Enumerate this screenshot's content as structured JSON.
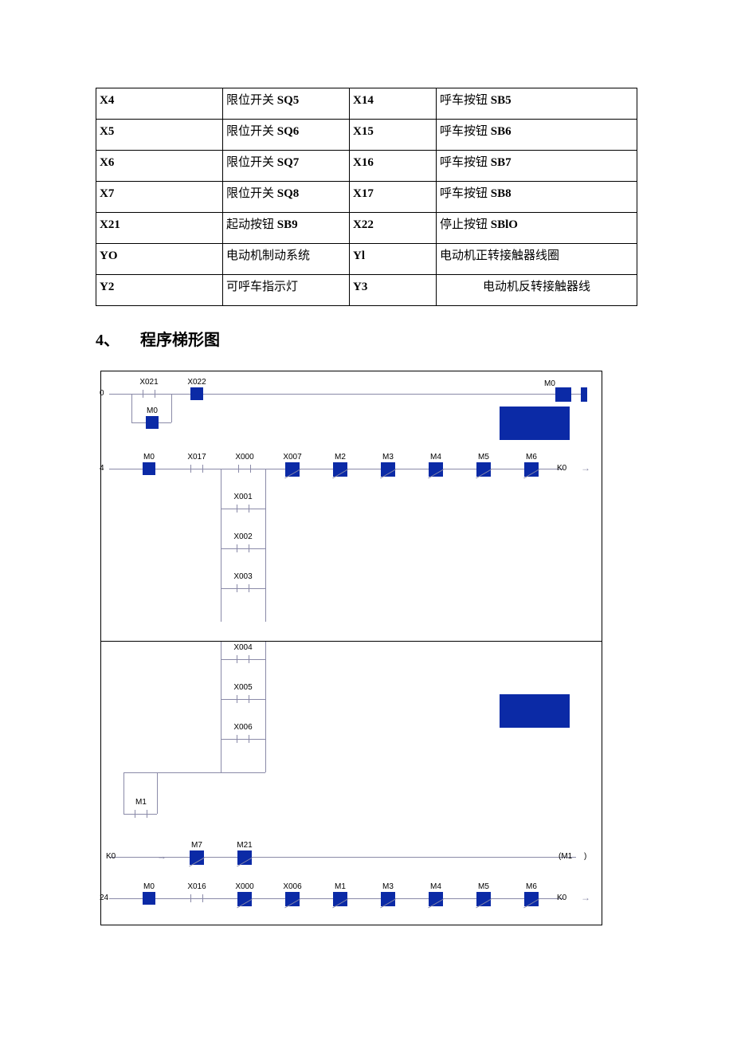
{
  "io_table": {
    "rows": [
      {
        "c1": "X4",
        "c2_pre": "限位开关 ",
        "c2_b": "SQ5",
        "c3": "X14",
        "c4_pre": "呼车按钮 ",
        "c4_b": "SB5"
      },
      {
        "c1": "X5",
        "c2_pre": "限位开关 ",
        "c2_b": "SQ6",
        "c3": "X15",
        "c4_pre": "呼车按钮 ",
        "c4_b": "SB6"
      },
      {
        "c1": "X6",
        "c2_pre": "限位开关 ",
        "c2_b": "SQ7",
        "c3": "X16",
        "c4_pre": "呼车按钮 ",
        "c4_b": "SB7"
      },
      {
        "c1": "X7",
        "c2_pre": "限位开关 ",
        "c2_b": "SQ8",
        "c3": "X17",
        "c4_pre": "呼车按钮 ",
        "c4_b": "SB8"
      },
      {
        "c1": "X21",
        "c2_pre": "起动按钮 ",
        "c2_b": "SB9",
        "c3": "X22",
        "c4_pre": "停止按钮 ",
        "c4_b": "SBlO"
      },
      {
        "c1": "YO",
        "c2_pre": "电动机制动系统",
        "c2_b": "",
        "c3": "Yl",
        "c4_pre": "电动机正转接触器线圈",
        "c4_b": "",
        "tight": true
      },
      {
        "c1": "Y2",
        "c2_pre": "可呼车指示灯",
        "c2_b": "",
        "c3": "Y3",
        "c4_pre": "电动机反转接触器线",
        "c4_b": "",
        "center4": true
      }
    ]
  },
  "section": {
    "num": "4、",
    "title": "程序梯形图"
  },
  "ladder": {
    "block1": {
      "step0": "0",
      "step4": "4",
      "r0": {
        "x021": "X021",
        "x022": "X022",
        "m0": "M0"
      },
      "r0b": {
        "m0": "M0"
      },
      "r1": {
        "m0": "M0",
        "x017": "X017",
        "x000": "X000",
        "x007": "X007",
        "m2": "M2",
        "m3": "M3",
        "m4": "M4",
        "m5": "M5",
        "m6": "M6",
        "k0": "K0"
      },
      "branch": [
        "X001",
        "X002",
        "X003"
      ]
    },
    "block2": {
      "branch": [
        "X004",
        "X005",
        "X006"
      ],
      "m1": "M1",
      "step24": "24",
      "rk": {
        "k0l": "K0",
        "m7": "M7",
        "m21": "M21",
        "m1c": "M1"
      },
      "r24": {
        "m0": "M0",
        "x016": "X016",
        "x000": "X000",
        "x006": "X006",
        "m1": "M1",
        "m3": "M3",
        "m4": "M4",
        "m5": "M5",
        "m6": "M6",
        "k0": "K0"
      }
    }
  }
}
